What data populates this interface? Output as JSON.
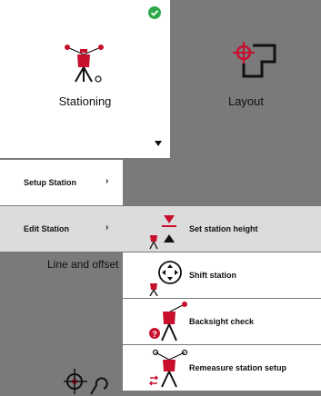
{
  "tiles": {
    "stationing": "Stationing",
    "layout": "Layout",
    "line_and_offset": "Line and offset"
  },
  "menu": {
    "items": [
      {
        "label": "Setup Station",
        "chevron": "›"
      },
      {
        "label": "Edit Station",
        "chevron": "›"
      }
    ]
  },
  "submenu": {
    "items": [
      {
        "label": "Set station height",
        "icon": "set-height-icon"
      },
      {
        "label": "Shift station",
        "icon": "shift-icon"
      },
      {
        "label": "Backsight check",
        "icon": "backsight-icon"
      },
      {
        "label": "Remeasure station setup",
        "icon": "remeasure-icon"
      }
    ]
  },
  "colors": {
    "accent_red": "#c8102e",
    "check_green": "#2ea84a",
    "selected_bg": "#dcdcdc",
    "dim_bg": "#7a7a7a"
  }
}
